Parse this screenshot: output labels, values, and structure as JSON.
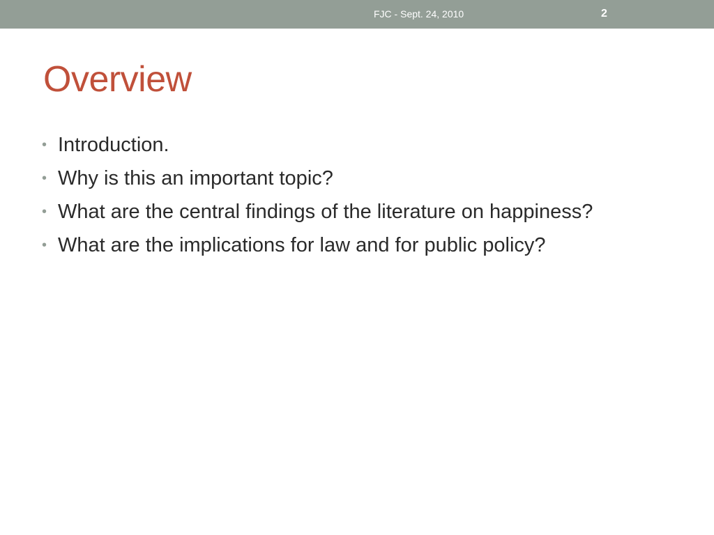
{
  "slide": {
    "footer_text": "FJC - Sept. 24, 2010",
    "slide_number": "2",
    "title": "Overview",
    "bullets": [
      "Introduction.",
      "Why is this an important topic?",
      "What are the central findings of the literature on happiness?",
      "What are the implications for law and for public policy?"
    ]
  },
  "colors": {
    "top_bar": "#939e96",
    "title": "#c0503a",
    "body_text": "#2a2a2a",
    "bullet_dot": "#939e96"
  }
}
